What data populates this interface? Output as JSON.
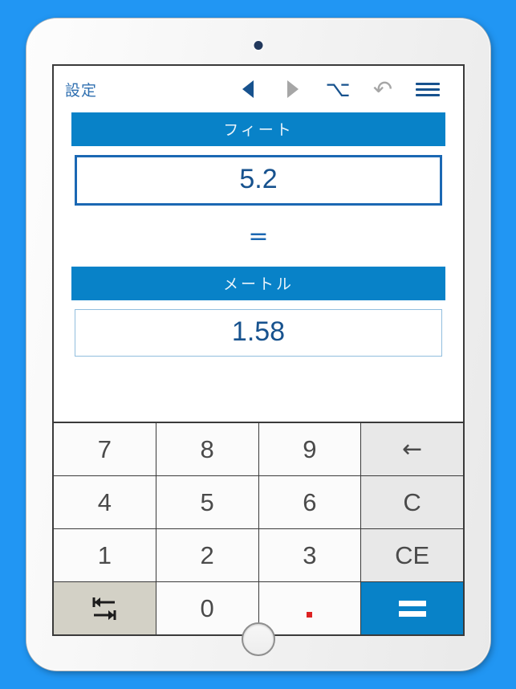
{
  "device": {
    "kind": "tablet",
    "camera": "front-camera",
    "home_button": "home-button"
  },
  "background_color": "#2196f3",
  "toolbar": {
    "settings_label": "設定",
    "icons": [
      {
        "name": "previous-arrow-icon",
        "glyph": "◀",
        "state": "enabled",
        "color": "#17528e"
      },
      {
        "name": "next-arrow-icon",
        "glyph": "▶",
        "state": "disabled",
        "color": "#a6a6a6"
      },
      {
        "name": "option-key-icon",
        "glyph": "⌥",
        "color": "#17528e"
      },
      {
        "name": "undo-icon",
        "glyph": "↺",
        "color": "#a6a6a6"
      },
      {
        "name": "menu-icon",
        "glyph": "≡",
        "color": "#17528e"
      }
    ]
  },
  "converter": {
    "from": {
      "unit_label": "フィート",
      "value": "5.2",
      "focused": true
    },
    "equals_symbol": "=",
    "to": {
      "unit_label": "メートル",
      "value": "1.58",
      "focused": false
    },
    "accent_color": "#0882c8",
    "value_text_color": "#17528e"
  },
  "keypad": {
    "keys": [
      {
        "label": "7",
        "name": "key-7",
        "style": "digit"
      },
      {
        "label": "8",
        "name": "key-8",
        "style": "digit"
      },
      {
        "label": "9",
        "name": "key-9",
        "style": "digit"
      },
      {
        "label": "←",
        "name": "backspace-key",
        "style": "fn"
      },
      {
        "label": "4",
        "name": "key-4",
        "style": "digit"
      },
      {
        "label": "5",
        "name": "key-5",
        "style": "digit"
      },
      {
        "label": "6",
        "name": "key-6",
        "style": "digit"
      },
      {
        "label": "C",
        "name": "clear-key",
        "style": "fn"
      },
      {
        "label": "1",
        "name": "key-1",
        "style": "digit"
      },
      {
        "label": "2",
        "name": "key-2",
        "style": "digit"
      },
      {
        "label": "3",
        "name": "key-3",
        "style": "digit"
      },
      {
        "label": "CE",
        "name": "clear-entry-key",
        "style": "fn"
      },
      {
        "label": "",
        "name": "swap-units-key",
        "style": "swap"
      },
      {
        "label": "0",
        "name": "key-0",
        "style": "digit"
      },
      {
        "label": ".",
        "name": "decimal-point-key",
        "style": "dot"
      },
      {
        "label": "=",
        "name": "equals-key",
        "style": "eq"
      }
    ],
    "decimal_marker_color": "#dd2222",
    "equals_key_color": "#0882c8",
    "swap_key_color": "#d3d1c6",
    "function_key_color": "#e8e8e8"
  }
}
